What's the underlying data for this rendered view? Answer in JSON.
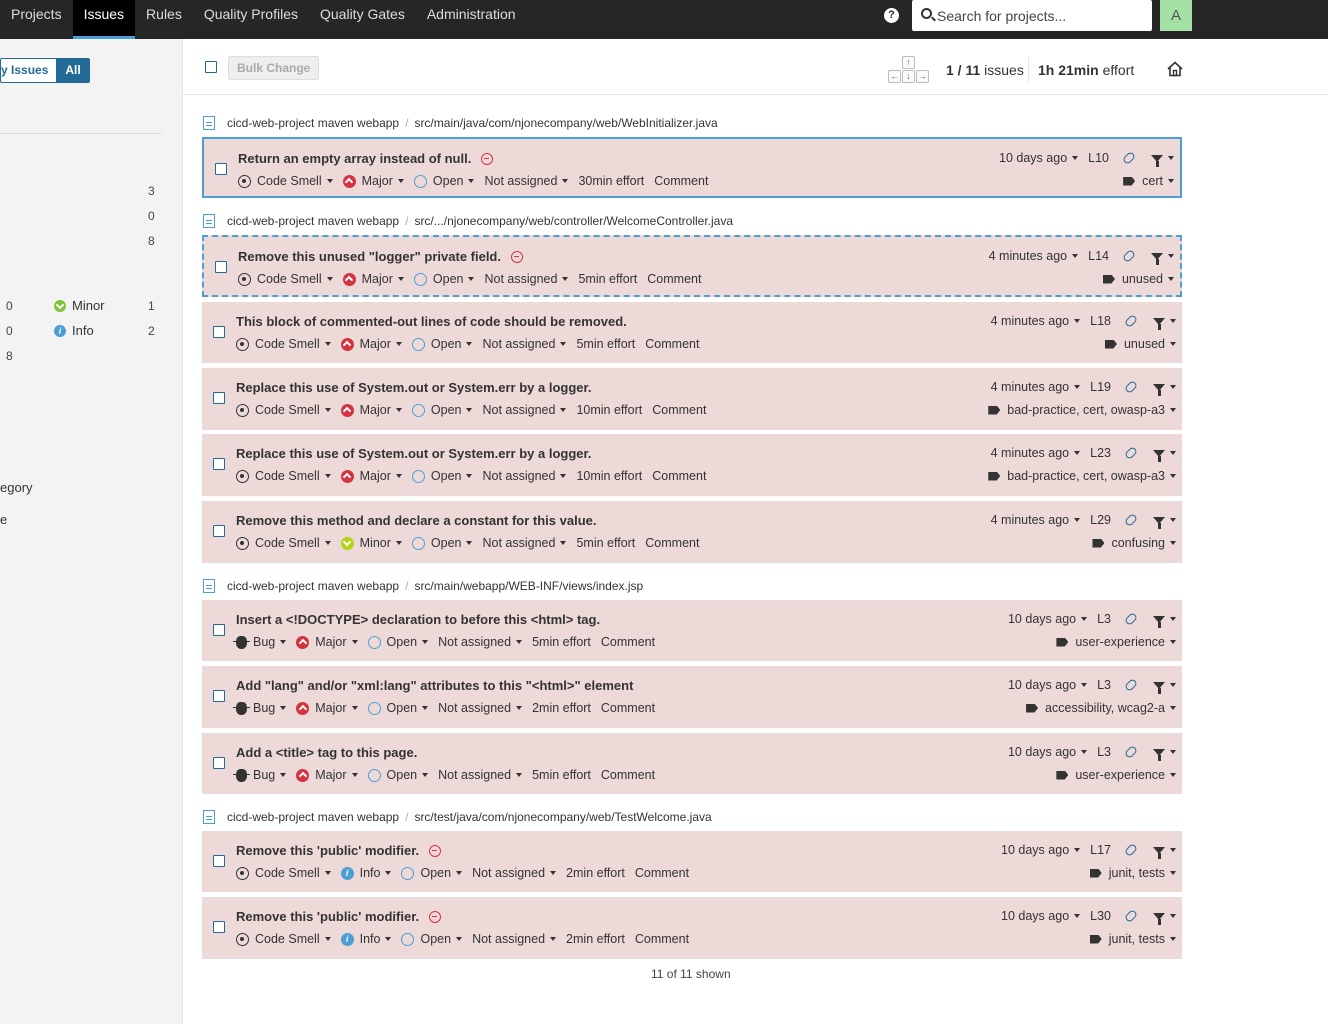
{
  "nav": {
    "items": [
      "Projects",
      "Issues",
      "Rules",
      "Quality Profiles",
      "Quality Gates",
      "Administration"
    ],
    "active": "Issues",
    "help": "?",
    "search_placeholder": "Search for projects...",
    "avatar_letter": "A"
  },
  "sidebar": {
    "my_issues": "y Issues",
    "all": "All",
    "type_counts": [
      "3",
      "0",
      "8"
    ],
    "severity_left_counts": [
      "0",
      "0",
      "8"
    ],
    "minor_label": "Minor",
    "minor_count": "1",
    "info_label": "Info",
    "info_count": "2",
    "category_fragment": "egory",
    "e_fragment": "e"
  },
  "toolbar": {
    "bulk_change": "Bulk Change",
    "kbd_up": "↑",
    "kbd_left": "←",
    "kbd_down": "↓",
    "kbd_right": "→",
    "position": "1 / 11",
    "issues_word": "issues",
    "effort_value": "1h 21min",
    "effort_word": "effort"
  },
  "components": [
    {
      "project": "cicd-web-project maven webapp",
      "path": "src/main/java/com/njonecompany/web/WebInitializer.java"
    },
    {
      "project": "cicd-web-project maven webapp",
      "path": "src/.../njonecompany/web/controller/WelcomeController.java"
    },
    {
      "project": "cicd-web-project maven webapp",
      "path": "src/main/webapp/WEB-INF/views/index.jsp"
    },
    {
      "project": "cicd-web-project maven webapp",
      "path": "src/test/java/com/njonecompany/web/TestWelcome.java"
    }
  ],
  "issues": [
    {
      "message": "Return an empty array instead of null.",
      "blocker": true,
      "type": "Code Smell",
      "severity": "Major",
      "status": "Open",
      "assignee": "Not assigned",
      "effort": "30min effort",
      "comment": "Comment",
      "age": "10 days ago",
      "line": "L10",
      "tags": "cert"
    },
    {
      "message": "Remove this unused \"logger\" private field.",
      "blocker": true,
      "type": "Code Smell",
      "severity": "Major",
      "status": "Open",
      "assignee": "Not assigned",
      "effort": "5min effort",
      "comment": "Comment",
      "age": "4 minutes ago",
      "line": "L14",
      "tags": "unused"
    },
    {
      "message": "This block of commented-out lines of code should be removed.",
      "blocker": false,
      "type": "Code Smell",
      "severity": "Major",
      "status": "Open",
      "assignee": "Not assigned",
      "effort": "5min effort",
      "comment": "Comment",
      "age": "4 minutes ago",
      "line": "L18",
      "tags": "unused"
    },
    {
      "message": "Replace this use of System.out or System.err by a logger.",
      "blocker": false,
      "type": "Code Smell",
      "severity": "Major",
      "status": "Open",
      "assignee": "Not assigned",
      "effort": "10min effort",
      "comment": "Comment",
      "age": "4 minutes ago",
      "line": "L19",
      "tags": "bad-practice, cert, owasp-a3"
    },
    {
      "message": "Replace this use of System.out or System.err by a logger.",
      "blocker": false,
      "type": "Code Smell",
      "severity": "Major",
      "status": "Open",
      "assignee": "Not assigned",
      "effort": "10min effort",
      "comment": "Comment",
      "age": "4 minutes ago",
      "line": "L23",
      "tags": "bad-practice, cert, owasp-a3"
    },
    {
      "message": "Remove this method and declare a constant for this value.",
      "blocker": false,
      "type": "Code Smell",
      "severity": "Minor",
      "status": "Open",
      "assignee": "Not assigned",
      "effort": "5min effort",
      "comment": "Comment",
      "age": "4 minutes ago",
      "line": "L29",
      "tags": "confusing"
    },
    {
      "message": "Insert a <!DOCTYPE> declaration to before this <html> tag.",
      "blocker": false,
      "type": "Bug",
      "severity": "Major",
      "status": "Open",
      "assignee": "Not assigned",
      "effort": "5min effort",
      "comment": "Comment",
      "age": "10 days ago",
      "line": "L3",
      "tags": "user-experience"
    },
    {
      "message": "Add \"lang\" and/or \"xml:lang\" attributes to this \"<html>\" element",
      "blocker": false,
      "type": "Bug",
      "severity": "Major",
      "status": "Open",
      "assignee": "Not assigned",
      "effort": "2min effort",
      "comment": "Comment",
      "age": "10 days ago",
      "line": "L3",
      "tags": "accessibility, wcag2-a"
    },
    {
      "message": "Add a <title> tag to this page.",
      "blocker": false,
      "type": "Bug",
      "severity": "Major",
      "status": "Open",
      "assignee": "Not assigned",
      "effort": "5min effort",
      "comment": "Comment",
      "age": "10 days ago",
      "line": "L3",
      "tags": "user-experience"
    },
    {
      "message": "Remove this 'public' modifier.",
      "blocker": true,
      "type": "Code Smell",
      "severity": "Info",
      "status": "Open",
      "assignee": "Not assigned",
      "effort": "2min effort",
      "comment": "Comment",
      "age": "10 days ago",
      "line": "L17",
      "tags": "junit, tests"
    },
    {
      "message": "Remove this 'public' modifier.",
      "blocker": true,
      "type": "Code Smell",
      "severity": "Info",
      "status": "Open",
      "assignee": "Not assigned",
      "effort": "2min effort",
      "comment": "Comment",
      "age": "10 days ago",
      "line": "L30",
      "tags": "junit, tests"
    }
  ],
  "footer": {
    "shown": "11 of 11 shown"
  }
}
